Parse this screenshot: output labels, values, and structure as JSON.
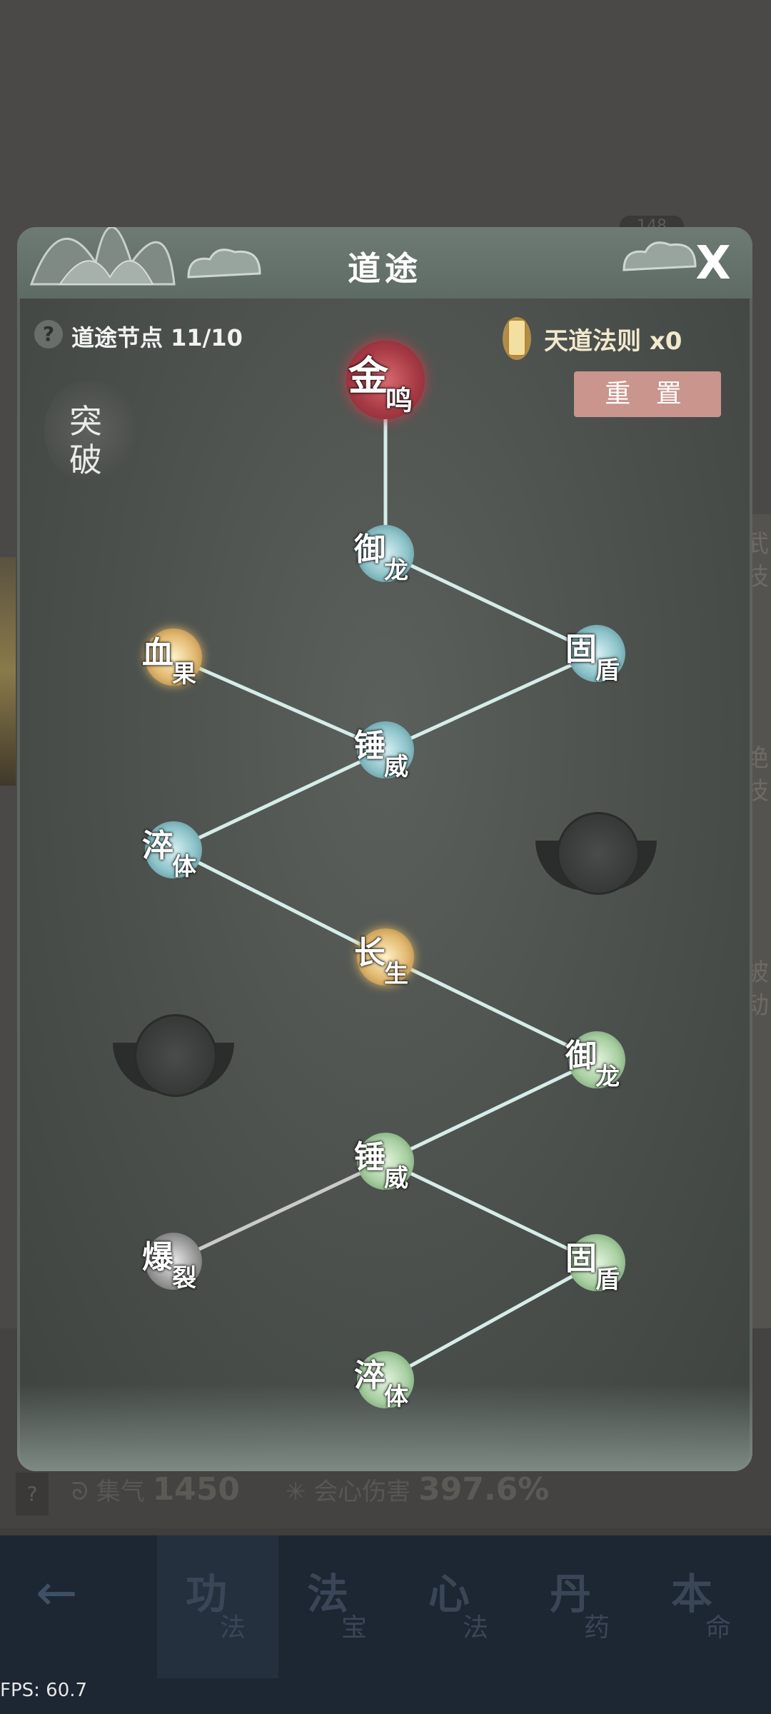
{
  "background": {
    "side_labels": [
      "武",
      "技",
      "绝",
      "技",
      "被",
      "动"
    ],
    "badge_number": "148",
    "stats": [
      {
        "label": "集气",
        "value": "1450"
      },
      {
        "label": "会心伤害",
        "value": "397.6%"
      }
    ]
  },
  "dialog": {
    "title": "道途",
    "close_label": "X",
    "nodes_count": "道途节点 11/10",
    "heavenly_law": "天道法则 x0",
    "reset_label": "重 置",
    "breakthrough": [
      "突",
      "破"
    ]
  },
  "tree_nodes": [
    {
      "id": "n1",
      "c1": "金",
      "c2": "鸣",
      "style": "red"
    },
    {
      "id": "n2",
      "c1": "御",
      "c2": "龙",
      "style": "blue"
    },
    {
      "id": "n3",
      "c1": "固",
      "c2": "盾",
      "style": "blue"
    },
    {
      "id": "n4",
      "c1": "血",
      "c2": "果",
      "style": "gold"
    },
    {
      "id": "n5",
      "c1": "锤",
      "c2": "威",
      "style": "blue"
    },
    {
      "id": "n6",
      "c1": "淬",
      "c2": "体",
      "style": "blue"
    },
    {
      "id": "n7",
      "c1": "长",
      "c2": "生",
      "style": "gold"
    },
    {
      "id": "n8",
      "c1": "御",
      "c2": "龙",
      "style": "green"
    },
    {
      "id": "n9",
      "c1": "锤",
      "c2": "威",
      "style": "green"
    },
    {
      "id": "n10",
      "c1": "爆",
      "c2": "裂",
      "style": "grey"
    },
    {
      "id": "n11",
      "c1": "固",
      "c2": "盾",
      "style": "green"
    },
    {
      "id": "n12",
      "c1": "淬",
      "c2": "体",
      "style": "green"
    }
  ],
  "bottom_nav": [
    {
      "big": "功",
      "small": "法",
      "active": true
    },
    {
      "big": "法",
      "small": "宝",
      "active": false
    },
    {
      "big": "心",
      "small": "法",
      "active": false
    },
    {
      "big": "丹",
      "small": "药",
      "active": false
    },
    {
      "big": "本",
      "small": "命",
      "active": false
    }
  ],
  "fps": "FPS: 60.7"
}
